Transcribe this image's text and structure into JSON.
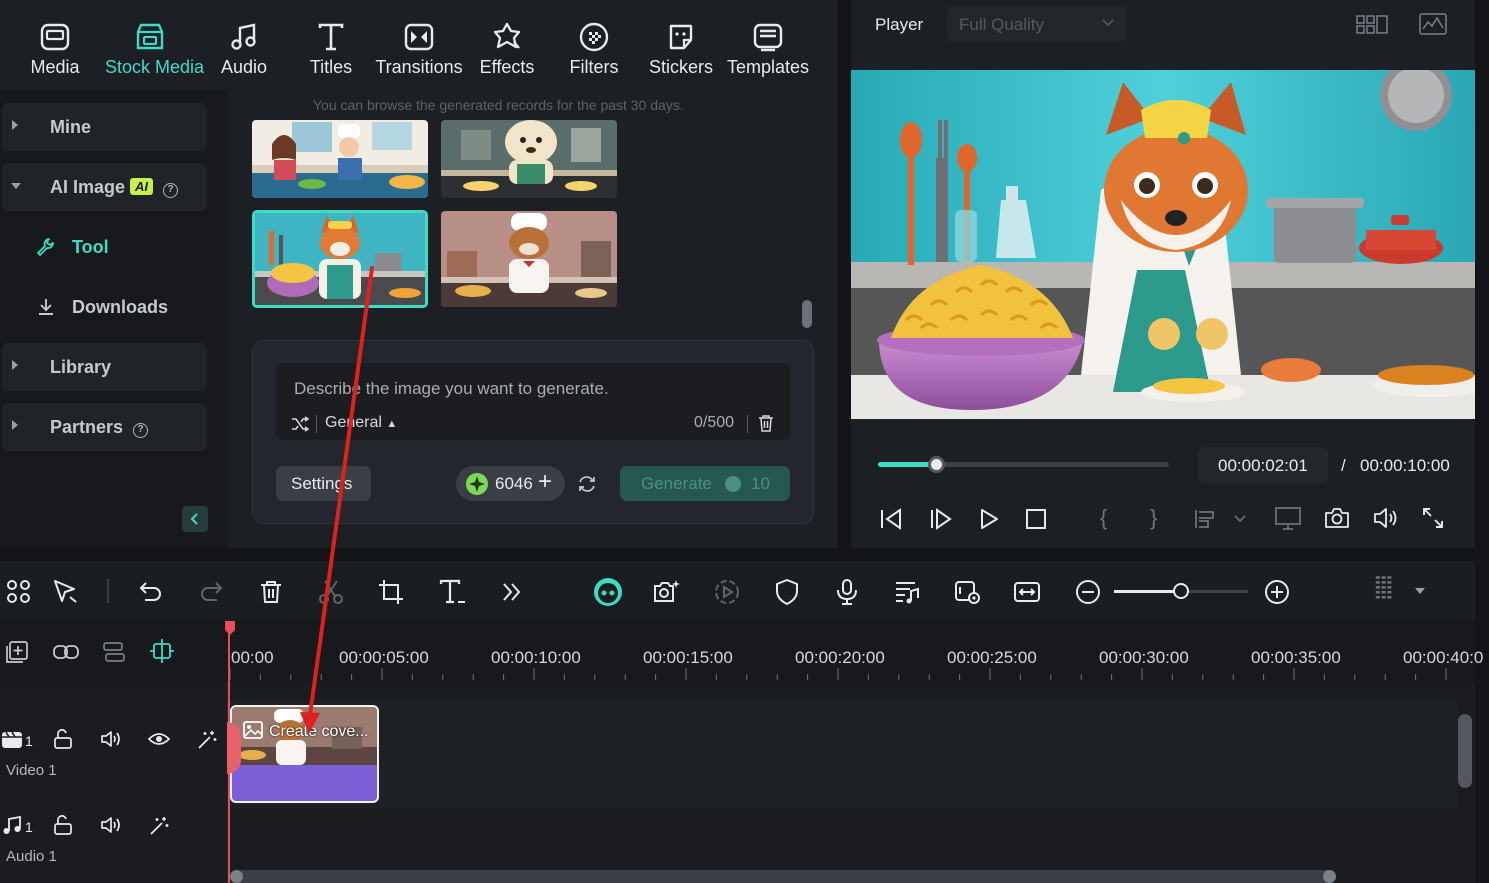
{
  "nav": {
    "items": [
      {
        "label": "Media",
        "icon": "media-icon"
      },
      {
        "label": "Stock Media",
        "icon": "stock-media-icon",
        "active": true
      },
      {
        "label": "Audio",
        "icon": "audio-icon"
      },
      {
        "label": "Titles",
        "icon": "titles-icon"
      },
      {
        "label": "Transitions",
        "icon": "transitions-icon"
      },
      {
        "label": "Effects",
        "icon": "effects-icon"
      },
      {
        "label": "Filters",
        "icon": "filters-icon"
      },
      {
        "label": "Stickers",
        "icon": "stickers-icon"
      },
      {
        "label": "Templates",
        "icon": "templates-icon"
      }
    ]
  },
  "sidebar": {
    "mine": "Mine",
    "ai_image": "AI Image",
    "ai_badge": "AI",
    "tool": "Tool",
    "downloads": "Downloads",
    "library": "Library",
    "partners": "Partners"
  },
  "browser": {
    "notice": "You can browse the generated records for the past 30 days."
  },
  "generator": {
    "placeholder": "Describe the image you want to generate.",
    "style": "General",
    "char_count": "0/500",
    "settings": "Settings",
    "credits": "6046",
    "generate": "Generate",
    "cost": "10"
  },
  "player": {
    "label": "Player",
    "quality": "Full Quality",
    "current_time": "00:00:02:01",
    "separator": "/",
    "total_time": "00:00:10:00",
    "progress": 0.2
  },
  "timeline": {
    "zoom_level": 0.5,
    "ticks": [
      "00:00",
      "00:00:05:00",
      "00:00:10:00",
      "00:00:15:00",
      "00:00:20:00",
      "00:00:25:00",
      "00:00:30:00",
      "00:00:35:00",
      "00:00:40:0"
    ],
    "video_track": {
      "index": "1",
      "name": "Video 1"
    },
    "audio_track": {
      "index": "1",
      "name": "Audio 1"
    },
    "clip_title": "Create cove..."
  },
  "colors": {
    "accent": "#3fdcc4",
    "playhead": "#e84e5a",
    "annotation": "#e0201c",
    "clip": "#7b5fd6"
  }
}
